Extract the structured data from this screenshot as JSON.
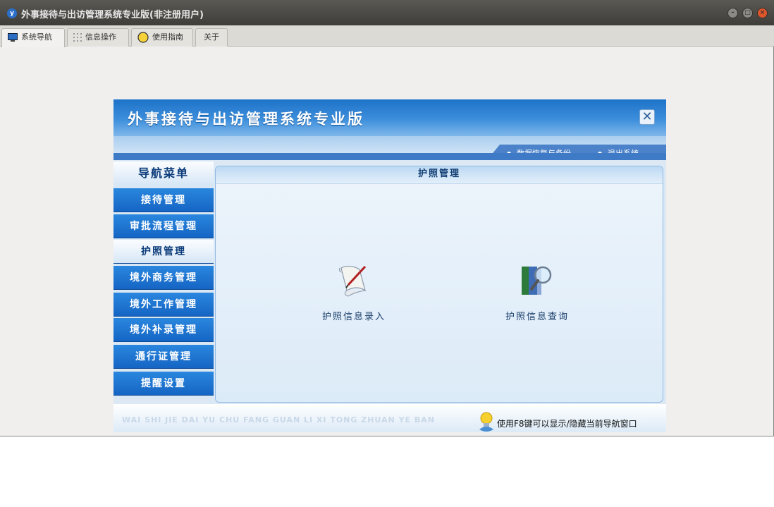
{
  "window": {
    "title": "外事接待与出访管理系统专业版(非注册用户)",
    "app_icon_letter": "y"
  },
  "tabs": [
    {
      "label": "系统导航",
      "icon": "monitor-icon",
      "active": true
    },
    {
      "label": "信息操作",
      "icon": "grid-icon",
      "active": false
    },
    {
      "label": "使用指南",
      "icon": "help-circle-icon",
      "active": false
    },
    {
      "label": "关于",
      "icon": "",
      "active": false
    }
  ],
  "panel": {
    "title": "外事接待与出访管理系统专业版",
    "links": {
      "restore": "数据恢复与备份",
      "exit": "退出系统"
    },
    "nav": {
      "header": "导航菜单",
      "items": [
        {
          "label": "接待管理",
          "active": false
        },
        {
          "label": "审批流程管理",
          "active": false
        },
        {
          "label": "护照管理",
          "active": true
        },
        {
          "label": "境外商务管理",
          "active": false
        },
        {
          "label": "境外工作管理",
          "active": false
        },
        {
          "label": "境外补录管理",
          "active": false
        },
        {
          "label": "通行证管理",
          "active": false
        },
        {
          "label": "提醒设置",
          "active": false
        }
      ]
    },
    "content": {
      "title": "护照管理",
      "functions": [
        {
          "label": "护照信息录入",
          "icon": "scroll-pen-icon"
        },
        {
          "label": "护照信息查询",
          "icon": "book-search-icon"
        }
      ]
    },
    "footer": {
      "pinyin": "WAI SHI JIE DAI YU CHU FANG GUAN LI XI TONG ZHUAN YE BAN",
      "tip": "使用F8键可以显示/隐藏当前导航窗口"
    }
  },
  "colors": {
    "accent": "#1565c4",
    "header_blue": "#1e72c8",
    "close_button": "#e0562b"
  }
}
